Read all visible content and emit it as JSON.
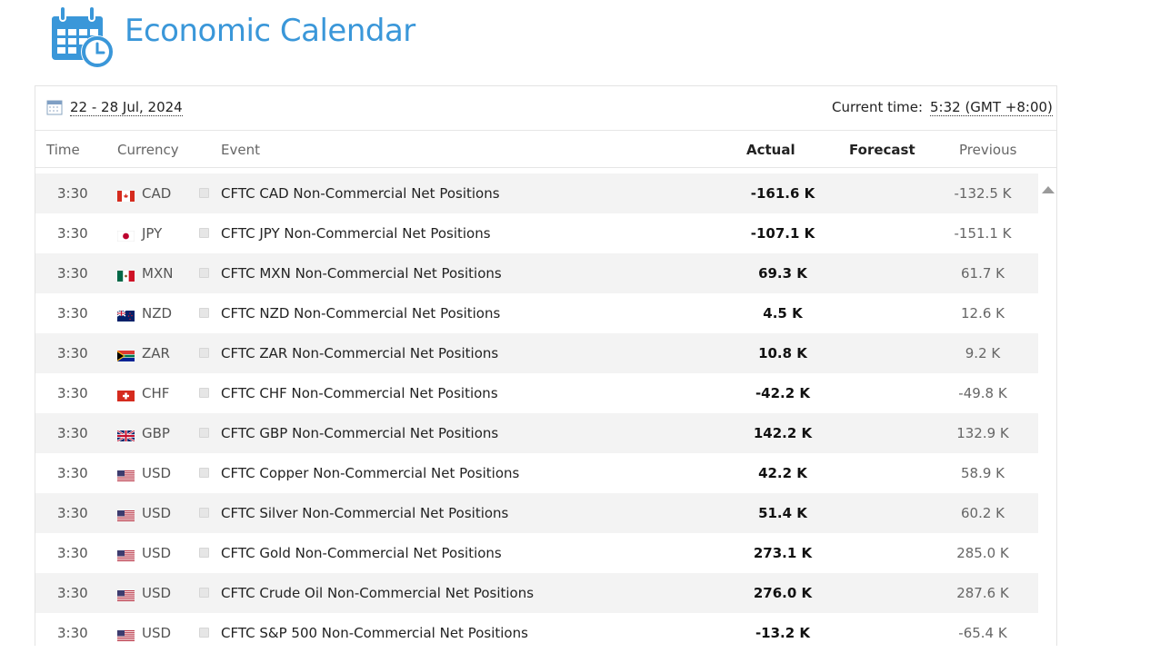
{
  "title": "Economic Calendar",
  "date_range": "22 - 28 Jul, 2024",
  "current_time_label": "Current time:",
  "current_time_value": "5:32 (GMT +8:00)",
  "headers": {
    "time": "Time",
    "currency": "Currency",
    "event": "Event",
    "actual": "Actual",
    "forecast": "Forecast",
    "previous": "Previous"
  },
  "rows": [
    {
      "time": "3:30",
      "currency": "CAD",
      "flag": "ca-flag",
      "event": "CFTC CAD Non-Commercial Net Positions",
      "actual": "-161.6 K",
      "forecast": "",
      "previous": "-132.5 K"
    },
    {
      "time": "3:30",
      "currency": "JPY",
      "flag": "jp-flag",
      "event": "CFTC JPY Non-Commercial Net Positions",
      "actual": "-107.1 K",
      "forecast": "",
      "previous": "-151.1 K"
    },
    {
      "time": "3:30",
      "currency": "MXN",
      "flag": "mx-flag",
      "event": "CFTC MXN Non-Commercial Net Positions",
      "actual": "69.3 K",
      "forecast": "",
      "previous": "61.7 K"
    },
    {
      "time": "3:30",
      "currency": "NZD",
      "flag": "nz-flag",
      "event": "CFTC NZD Non-Commercial Net Positions",
      "actual": "4.5 K",
      "forecast": "",
      "previous": "12.6 K"
    },
    {
      "time": "3:30",
      "currency": "ZAR",
      "flag": "za-flag",
      "event": "CFTC ZAR Non-Commercial Net Positions",
      "actual": "10.8 K",
      "forecast": "",
      "previous": "9.2 K"
    },
    {
      "time": "3:30",
      "currency": "CHF",
      "flag": "ch-flag",
      "event": "CFTC CHF Non-Commercial Net Positions",
      "actual": "-42.2 K",
      "forecast": "",
      "previous": "-49.8 K"
    },
    {
      "time": "3:30",
      "currency": "GBP",
      "flag": "gb-flag",
      "event": "CFTC GBP Non-Commercial Net Positions",
      "actual": "142.2 K",
      "forecast": "",
      "previous": "132.9 K"
    },
    {
      "time": "3:30",
      "currency": "USD",
      "flag": "us-flag",
      "event": "CFTC Copper Non-Commercial Net Positions",
      "actual": "42.2 K",
      "forecast": "",
      "previous": "58.9 K"
    },
    {
      "time": "3:30",
      "currency": "USD",
      "flag": "us-flag",
      "event": "CFTC Silver Non-Commercial Net Positions",
      "actual": "51.4 K",
      "forecast": "",
      "previous": "60.2 K"
    },
    {
      "time": "3:30",
      "currency": "USD",
      "flag": "us-flag",
      "event": "CFTC Gold Non-Commercial Net Positions",
      "actual": "273.1 K",
      "forecast": "",
      "previous": "285.0 K"
    },
    {
      "time": "3:30",
      "currency": "USD",
      "flag": "us-flag",
      "event": "CFTC Crude Oil Non-Commercial Net Positions",
      "actual": "276.0 K",
      "forecast": "",
      "previous": "287.6 K"
    },
    {
      "time": "3:30",
      "currency": "USD",
      "flag": "us-flag",
      "event": "CFTC S&P 500 Non-Commercial Net Positions",
      "actual": "-13.2 K",
      "forecast": "",
      "previous": "-65.4 K"
    }
  ],
  "colors": {
    "title": "#3a97d9",
    "row_shade": "#f3f3f3"
  },
  "icons": {
    "logo": "calendar-clock-icon",
    "date": "calendar-icon",
    "scroll": "scroll-up-arrow-icon"
  }
}
